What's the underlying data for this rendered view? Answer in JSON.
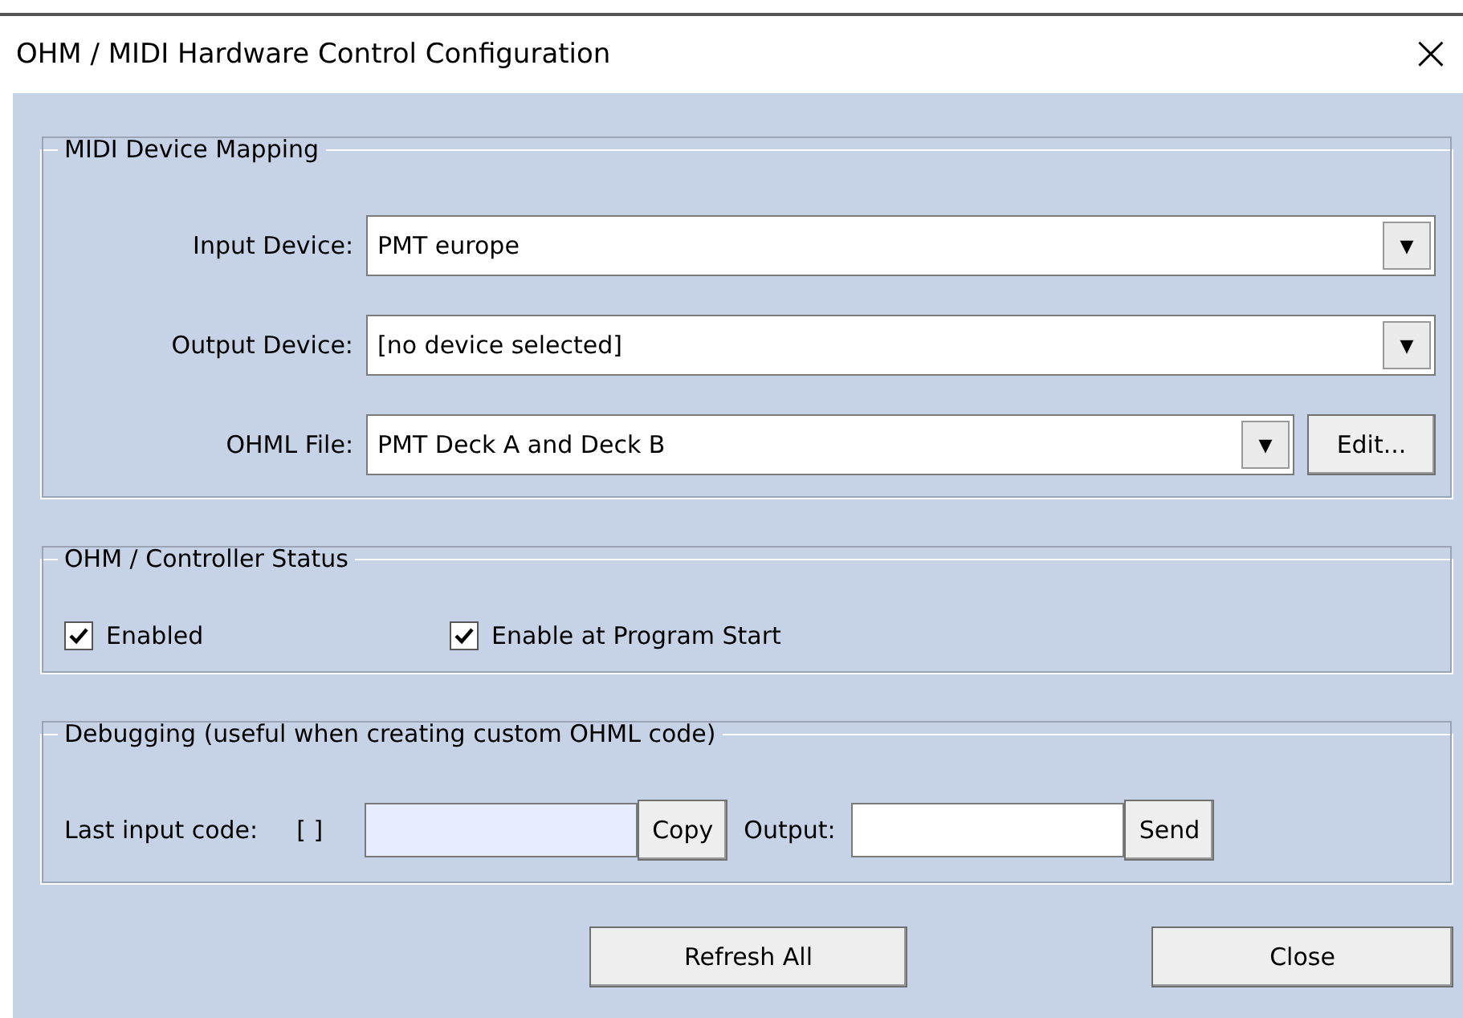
{
  "window": {
    "title": "OHM / MIDI Hardware Control Configuration",
    "close": "×"
  },
  "mapping": {
    "legend": "MIDI Device Mapping",
    "rows": [
      {
        "label": "Input Device:",
        "value": "PMT europe",
        "arrow": "▼"
      },
      {
        "label": "Output Device:",
        "value": "[no device selected]",
        "arrow": "▼"
      },
      {
        "label": "OHML File:",
        "value": "PMT Deck A and Deck B",
        "arrow": "▼",
        "button": "Edit..."
      }
    ]
  },
  "status": {
    "legend": "OHM / Controller Status",
    "checkboxes": [
      {
        "label": "Enabled",
        "checked": true
      },
      {
        "label": "Enable at Program Start",
        "checked": true
      }
    ]
  },
  "debugging": {
    "legend": "Debugging (useful when creating custom OHML code)",
    "last_input_label": "Last input code:",
    "last_input_value": "[ ]",
    "copy_button": "Copy",
    "output_label": "Output:",
    "send_button": "Send"
  },
  "buttons": [
    "Refresh All",
    "Close"
  ]
}
